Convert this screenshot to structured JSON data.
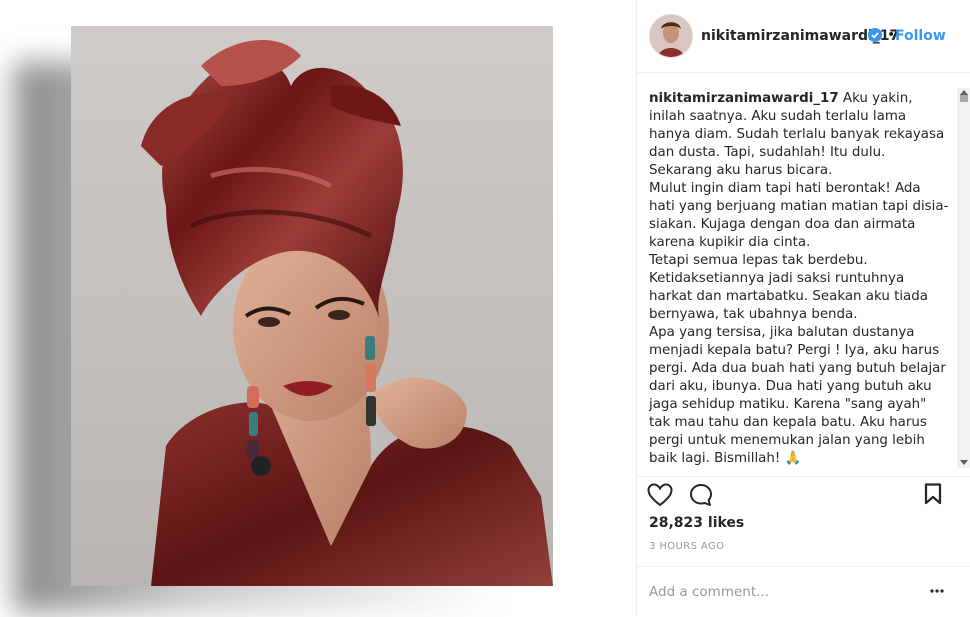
{
  "post": {
    "username": "nikitamirzanimawardi_17",
    "follow_label": "Follow",
    "separator": "•",
    "verified_icon": "verified-badge-icon"
  },
  "caption": {
    "username": "nikitamirzanimawardi_17",
    "text": " Aku yakin, inilah saatnya. Aku sudah terlalu lama hanya diam. Sudah terlalu banyak rekayasa dan dusta. Tapi, sudahlah! Itu dulu. Sekarang aku harus bicara.\nMulut ingin diam tapi hati berontak! Ada hati yang berjuang matian matian tapi disia-siakan. Kujaga dengan doa dan airmata karena kupikir dia cinta.\nTetapi semua lepas tak berdebu. Ketidaksetiannya jadi saksi runtuhnya harkat dan martabatku. Seakan aku tiada bernyawa, tak ubahnya benda.\nApa yang tersisa, jika balutan dustanya menjadi kepala batu? Pergi ! Iya, aku harus pergi. Ada dua buah hati yang butuh belajar dari aku, ibunya. Dua hati yang butuh aku jaga sehidup matiku. Karena \"sang ayah\" tak mau tahu dan kepala batu. Aku harus pergi untuk menemukan jalan yang lebih baik lagi. Bismillah! 🙏"
  },
  "stats": {
    "likes": "28,823 likes",
    "time": "3 HOURS AGO"
  },
  "comment": {
    "placeholder": "Add a comment..."
  },
  "icons": {
    "like": "heart-icon",
    "comment": "comment-bubble-icon",
    "save": "bookmark-icon",
    "more": "more-options-icon"
  },
  "colors": {
    "accent": "#3897f0",
    "text": "#262626",
    "muted": "#999999",
    "fabric": "#7a1e1e"
  }
}
